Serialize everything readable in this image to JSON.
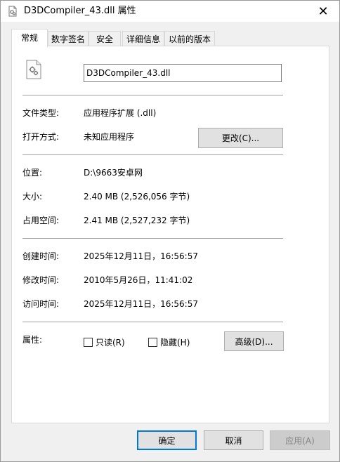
{
  "window": {
    "title": "D3DCompiler_43.dll 属性",
    "close_glyph": "✕"
  },
  "tabs": [
    {
      "label": "常规",
      "active": true
    },
    {
      "label": "数字签名",
      "active": false
    },
    {
      "label": "安全",
      "active": false
    },
    {
      "label": "详细信息",
      "active": false
    },
    {
      "label": "以前的版本",
      "active": false
    }
  ],
  "general": {
    "file_icon": "dll-file-gear-icon",
    "file_name": "D3DCompiler_43.dll",
    "file_type_label": "文件类型:",
    "file_type_value": "应用程序扩展 (.dll)",
    "opens_with_label": "打开方式:",
    "opens_with_value": "未知应用程序",
    "change_button": "更改(C)...",
    "location_label": "位置:",
    "location_value": "D:\\9663安卓网",
    "size_label": "大小:",
    "size_value": "2.40 MB (2,526,056 字节)",
    "size_on_disk_label": "占用空间:",
    "size_on_disk_value": "2.41 MB (2,527,232 字节)",
    "created_label": "创建时间:",
    "created_value": "2025年12月11日，16:56:57",
    "modified_label": "修改时间:",
    "modified_value": "2010年5月26日，11:41:02",
    "accessed_label": "访问时间:",
    "accessed_value": "2025年12月11日，16:56:57",
    "attributes_label": "属性:",
    "readonly_label": "只读(R)",
    "readonly_checked": false,
    "hidden_label": "隐藏(H)",
    "hidden_checked": false,
    "advanced_button": "高级(D)..."
  },
  "footer": {
    "ok": "确定",
    "cancel": "取消",
    "apply": "应用(A)"
  },
  "colors": {
    "accent": "#0078d7",
    "panel_bg": "#ffffff",
    "window_bg": "#f0f0f0"
  }
}
